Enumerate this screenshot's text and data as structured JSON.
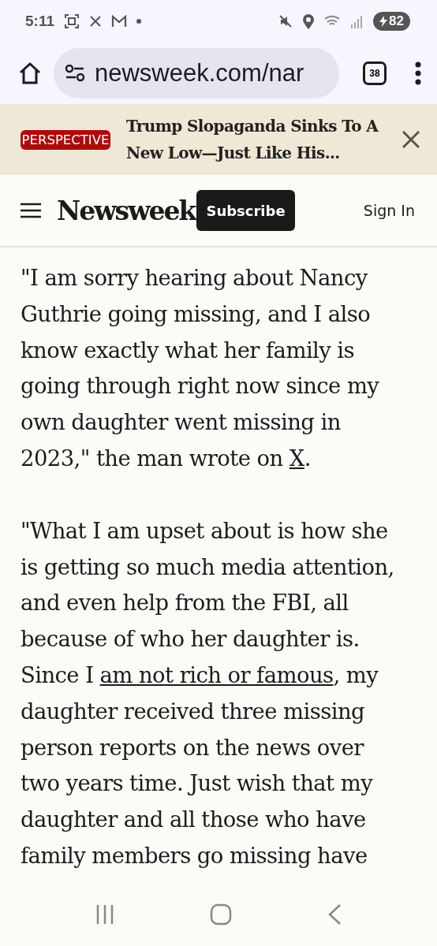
{
  "status_bar": {
    "time": "5:11",
    "battery": "82"
  },
  "browser": {
    "url": "newsweek.com/nar",
    "tab_count": "38"
  },
  "promo": {
    "tag": "PERSPECTIVE",
    "headline": "Trump Slopaganda Sinks To A New Low—Just Like His..."
  },
  "header": {
    "logo": "Newsweek",
    "subscribe": "Subscribe",
    "sign_in": "Sign In"
  },
  "article": {
    "paragraphs": [
      {
        "segments": [
          {
            "text": "\"I am sorry hearing about Nancy Guthrie going missing, and I also know exactly what her family is going through right now since my own daughter went missing in 2023,\" the man wrote on ",
            "link": false
          },
          {
            "text": "X",
            "link": true
          },
          {
            "text": ".",
            "link": false
          }
        ]
      },
      {
        "segments": [
          {
            "text": "\"What I am upset about is how she is getting so much media attention, and even help from the FBI, all because of who her daughter is. Since I ",
            "link": false
          },
          {
            "text": "am not rich or famous",
            "link": true
          },
          {
            "text": ", my daughter received three missing person reports on the news over two years time. Just wish that my daughter and all those who have family members go missing have",
            "link": false
          }
        ]
      }
    ]
  }
}
